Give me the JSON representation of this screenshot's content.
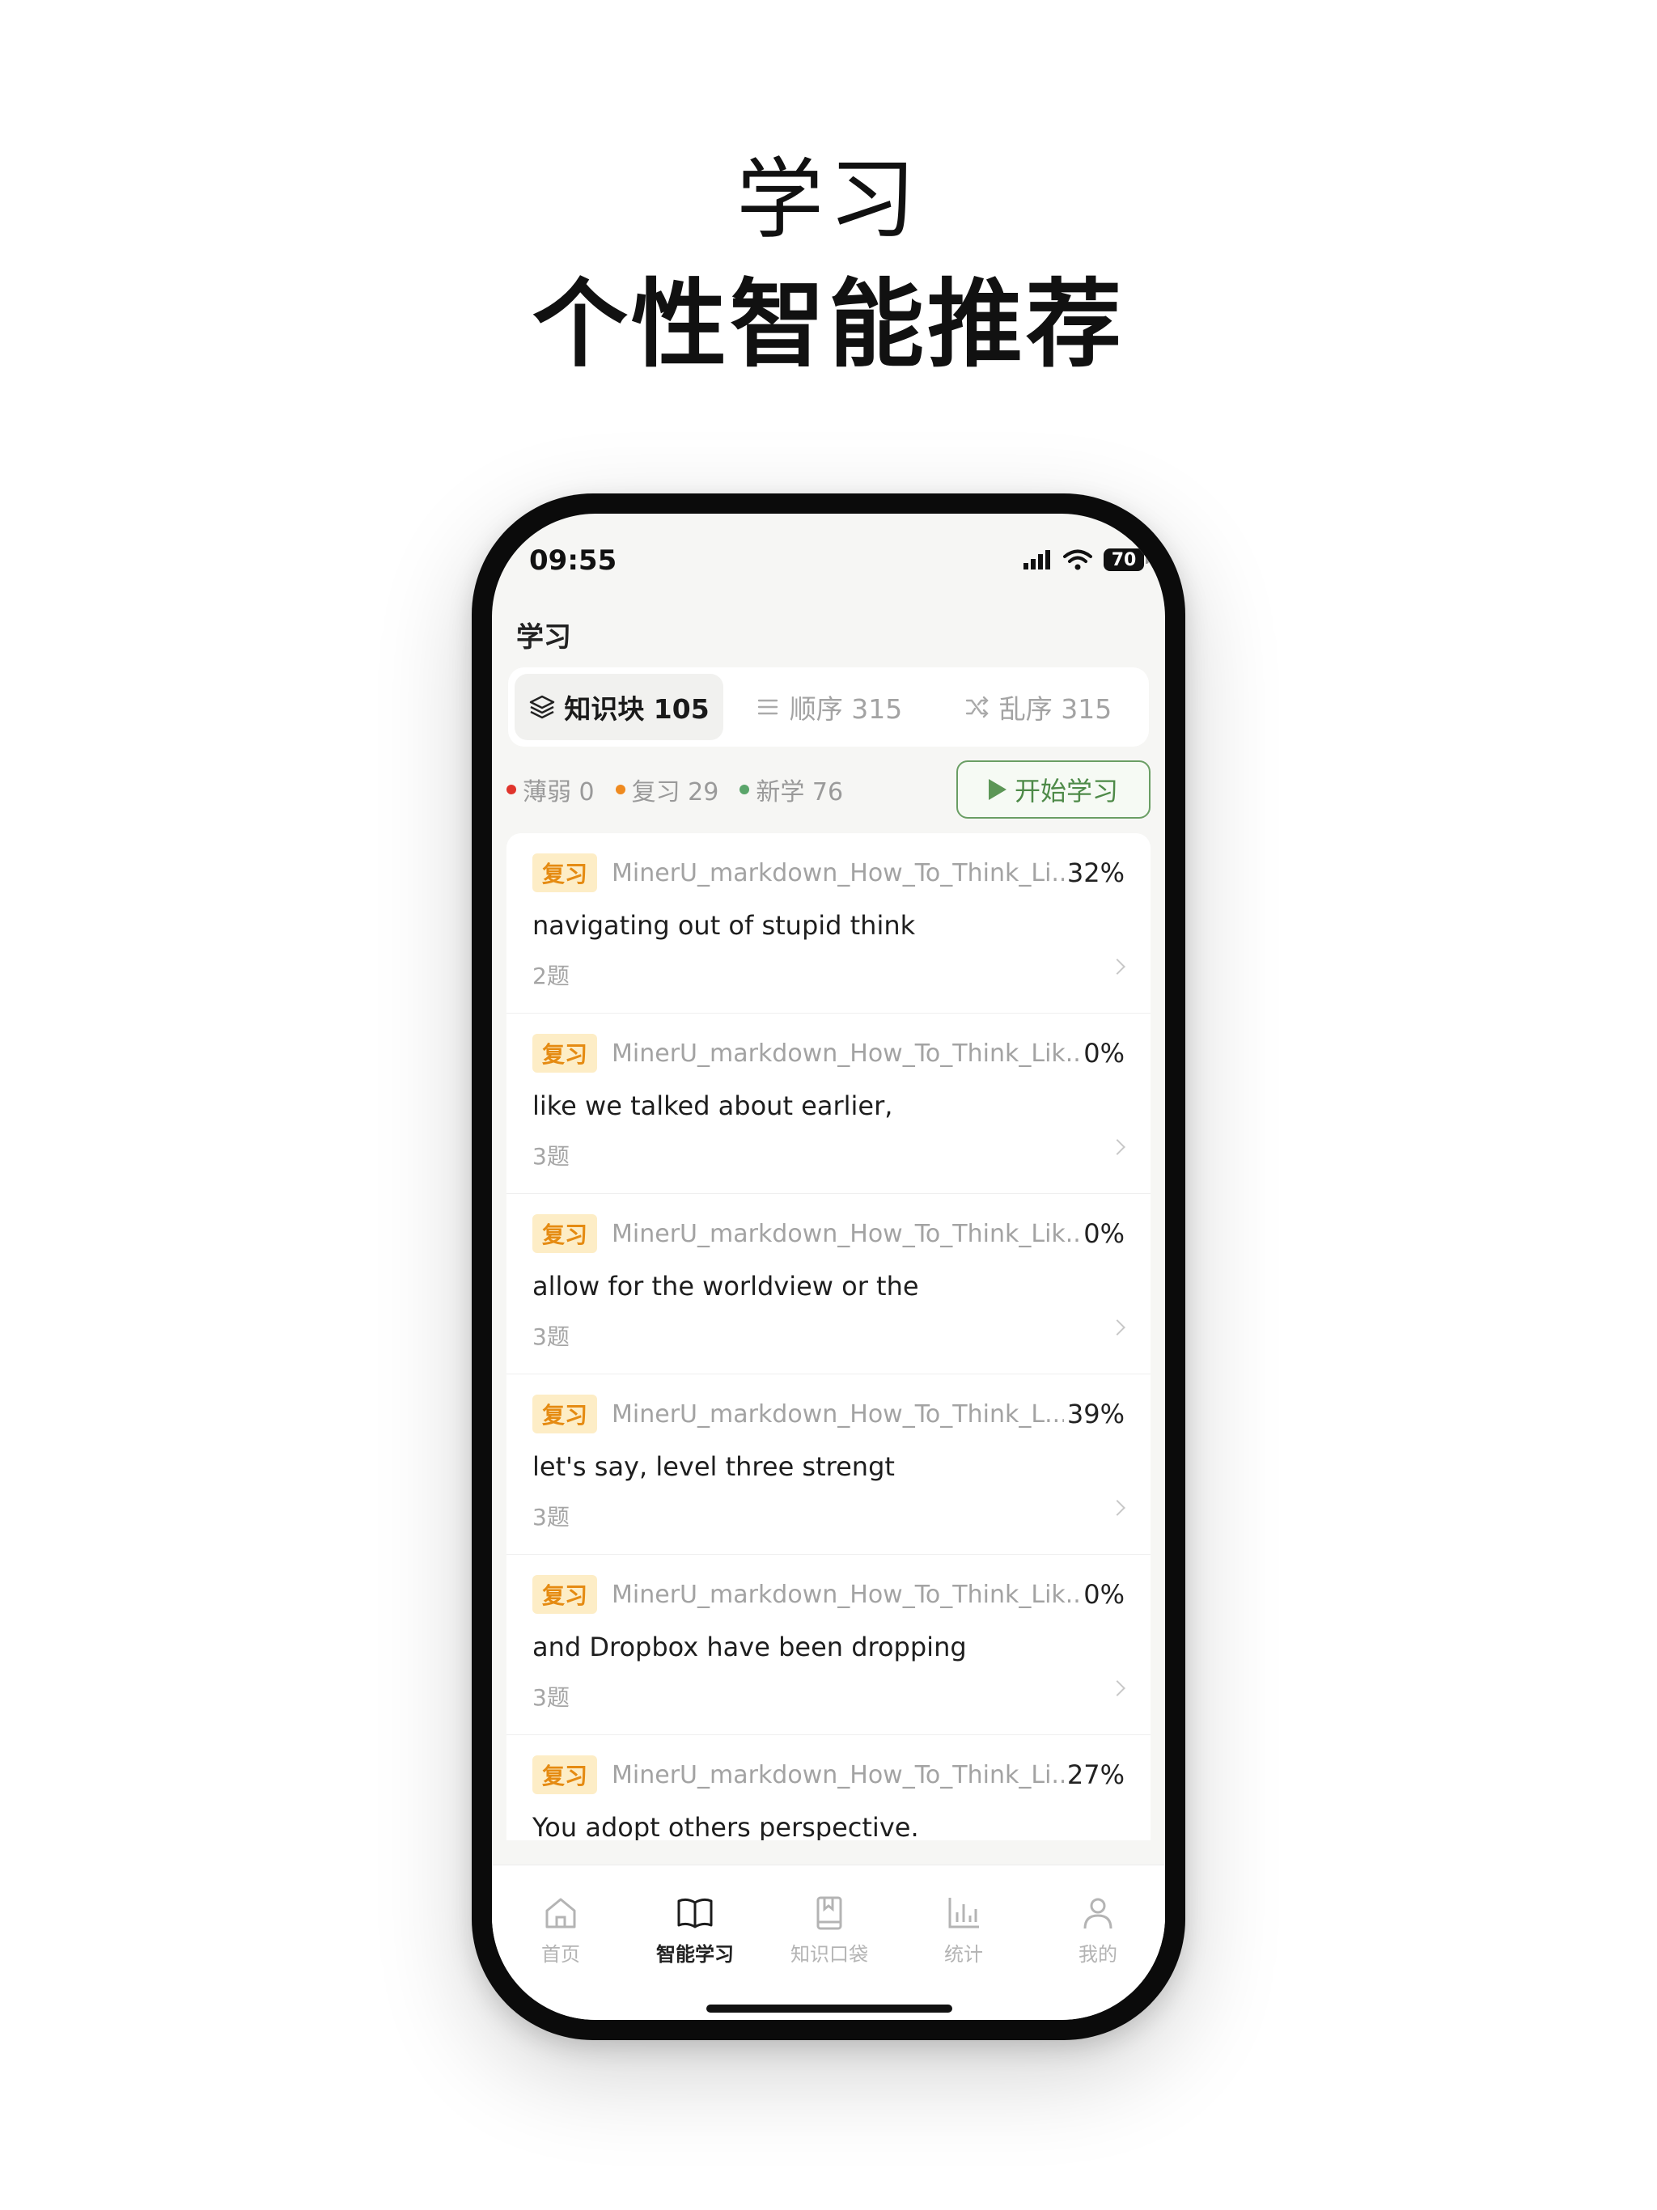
{
  "headline": {
    "line1": "学习",
    "line2": "个性智能推荐"
  },
  "status": {
    "time": "09:55",
    "battery": "70"
  },
  "page": {
    "title": "学习"
  },
  "segments": [
    {
      "label": "知识块 105",
      "icon": "stack-icon",
      "active": true
    },
    {
      "label": "顺序 315",
      "icon": "list-icon",
      "active": false
    },
    {
      "label": "乱序 315",
      "icon": "shuffle-icon",
      "active": false
    }
  ],
  "filters": [
    {
      "label": "薄弱 0",
      "color": "#e0342c"
    },
    {
      "label": "复习 29",
      "color": "#ef8a1f"
    },
    {
      "label": "新学 76",
      "color": "#5aa56a"
    }
  ],
  "start_button": {
    "label": "开始学习",
    "icon": "play-icon"
  },
  "cards": [
    {
      "tag": "复习",
      "source": "MinerU_markdown_How_To_Think_Li...",
      "percent": "32%",
      "text": "navigating out of stupid think",
      "count": "2题"
    },
    {
      "tag": "复习",
      "source": "MinerU_markdown_How_To_Think_Lik...",
      "percent": "0%",
      "text": "like we talked about earlier,",
      "count": "3题"
    },
    {
      "tag": "复习",
      "source": "MinerU_markdown_How_To_Think_Lik...",
      "percent": "0%",
      "text": "allow for the worldview or the",
      "count": "3题"
    },
    {
      "tag": "复习",
      "source": "MinerU_markdown_How_To_Think_L...",
      "percent": "39%",
      "text": "let's say, level three strengt",
      "count": "3题"
    },
    {
      "tag": "复习",
      "source": "MinerU_markdown_How_To_Think_Lik...",
      "percent": "0%",
      "text": "and Dropbox have been dropping",
      "count": "3题"
    },
    {
      "tag": "复习",
      "source": "MinerU_markdown_How_To_Think_Li...",
      "percent": "27%",
      "text": "You adopt others perspective.",
      "count": ""
    }
  ],
  "tabbar": [
    {
      "label": "首页",
      "icon": "home-icon",
      "active": false
    },
    {
      "label": "智能学习",
      "icon": "book-open-icon",
      "active": true
    },
    {
      "label": "知识口袋",
      "icon": "bookmark-book-icon",
      "active": false
    },
    {
      "label": "统计",
      "icon": "bar-chart-icon",
      "active": false
    },
    {
      "label": "我的",
      "icon": "user-icon",
      "active": false
    }
  ]
}
